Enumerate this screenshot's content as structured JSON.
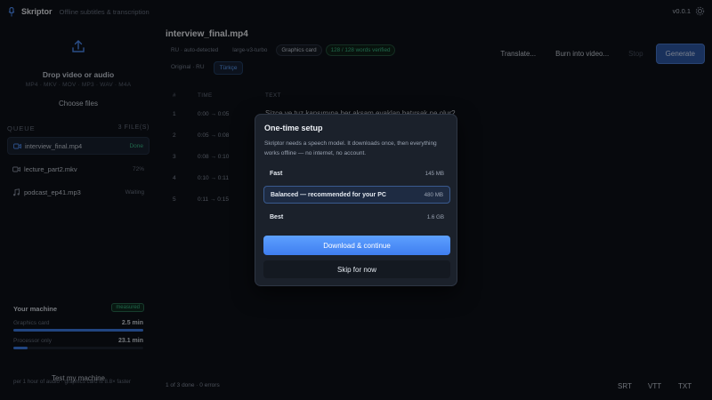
{
  "app": {
    "name": "Skriptor",
    "subtitle": "Offline subtitles & transcription",
    "version": "v0.0.1",
    "icons": {
      "logo": "microphone-icon",
      "settings": "gear-icon"
    }
  },
  "sidebar": {
    "drop": {
      "title": "Drop video or audio",
      "formats": "MP4 · MKV · MOV · MP3 · WAV · M4A",
      "choose_label": "Choose files",
      "icon": "upload-icon"
    },
    "queue": {
      "label": "QUEUE",
      "count": "3 FILE(S)",
      "items": [
        {
          "name": "interview_final.mp4",
          "status": "Done",
          "icon": "video-icon"
        },
        {
          "name": "lecture_part2.mkv",
          "status": "72%",
          "icon": "video-icon"
        },
        {
          "name": "podcast_ep41.mp3",
          "status": "Waiting",
          "icon": "music-icon"
        }
      ]
    },
    "machine": {
      "title": "Your machine",
      "badge": "measured",
      "rows": [
        {
          "label": "Graphics card",
          "value": "2.5 min",
          "fill_fraction": 1.0
        },
        {
          "label": "Processor only",
          "value": "23.1 min",
          "fill_fraction": 0.11
        }
      ],
      "note": "per 1 hour of audio · graphics card is 8.8× faster",
      "test_label": "Test my machine"
    }
  },
  "main": {
    "file_title": "interview_final.mp4",
    "chips": [
      "RU · auto-detected",
      "large-v3-turbo",
      "Graphics card",
      "128 / 128 words verified"
    ],
    "lang_tabs": [
      "Original · RU",
      "Türkçe"
    ],
    "actions": {
      "translate": "Translate...",
      "burn": "Burn into video...",
      "stop": "Stop",
      "generate": "Generate"
    },
    "table": {
      "headers": [
        "#",
        "TIME",
        "TEXT"
      ],
      "rows": [
        {
          "n": "1",
          "time": "0:00 → 0:05",
          "text": "Sizce ve tuz kanşımına her akşam eyaklan batırsak ne olur?"
        },
        {
          "n": "2",
          "time": "0:05 → 0:08",
          "text": ""
        },
        {
          "n": "3",
          "time": "0:08 → 0:10",
          "text": ""
        },
        {
          "n": "4",
          "time": "0:10 → 0:11",
          "text": ""
        },
        {
          "n": "5",
          "time": "0:11 → 0:15",
          "text": ""
        }
      ]
    },
    "footer": {
      "status": "1 of 3 done · 0 errors",
      "exports": [
        "SRT",
        "VTT",
        "TXT"
      ]
    }
  },
  "modal": {
    "title": "One-time setup",
    "description": "Skriptor needs a speech model. It downloads once, then everything works offline — no internet, no account.",
    "options": [
      {
        "name": "Fast",
        "size": "145 MB"
      },
      {
        "name": "Balanced — recommended for your PC",
        "size": "480 MB"
      },
      {
        "name": "Best",
        "size": "1.6 GB"
      }
    ],
    "primary_label": "Download & continue",
    "secondary_label": "Skip for now"
  }
}
